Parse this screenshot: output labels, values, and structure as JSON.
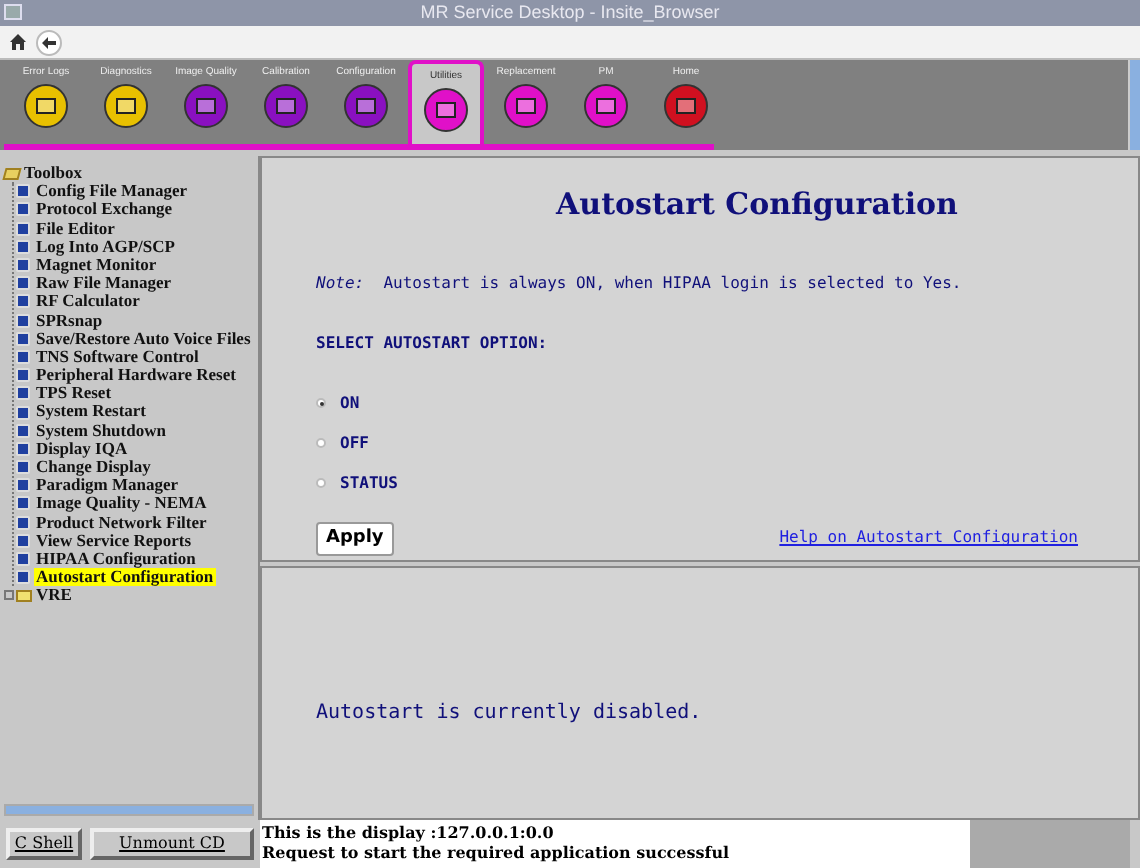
{
  "window": {
    "title": "MR Service Desktop - Insite_Browser"
  },
  "toolbar": [
    {
      "label": "Error Logs",
      "color": "#e8c000",
      "selected": false
    },
    {
      "label": "Diagnostics",
      "color": "#e8c000",
      "selected": false
    },
    {
      "label": "Image Quality",
      "color": "#8a10c0",
      "selected": false
    },
    {
      "label": "Calibration",
      "color": "#8a10c0",
      "selected": false
    },
    {
      "label": "Configuration",
      "color": "#8a10c0",
      "selected": false
    },
    {
      "label": "Utilities",
      "color": "#e010c8",
      "selected": true
    },
    {
      "label": "Replacement",
      "color": "#e010c8",
      "selected": false
    },
    {
      "label": "PM",
      "color": "#e010c8",
      "selected": false
    },
    {
      "label": "Home",
      "color": "#d01020",
      "selected": false
    }
  ],
  "tree": [
    {
      "label": "Toolbox",
      "expanded": true,
      "children": [
        {
          "label": "Config File Manager",
          "selected": false
        },
        {
          "label": "Protocol Exchange",
          "selected": false
        },
        {
          "label": "File Editor",
          "selected": false
        },
        {
          "label": "Log Into AGP/SCP",
          "selected": false
        },
        {
          "label": "Magnet Monitor",
          "selected": false
        },
        {
          "label": "Raw File Manager",
          "selected": false
        },
        {
          "label": "RF Calculator",
          "selected": false
        },
        {
          "label": "SPRsnap",
          "selected": false
        },
        {
          "label": "Save/Restore Auto Voice Files",
          "selected": false
        },
        {
          "label": "TNS Software Control",
          "selected": false
        },
        {
          "label": "Peripheral Hardware Reset",
          "selected": false
        },
        {
          "label": "TPS Reset",
          "selected": false
        },
        {
          "label": "System Restart",
          "selected": false
        },
        {
          "label": "System Shutdown",
          "selected": false
        },
        {
          "label": "Display IQA",
          "selected": false
        },
        {
          "label": "Change Display",
          "selected": false
        },
        {
          "label": "Paradigm Manager",
          "selected": false
        },
        {
          "label": "Image Quality - NEMA",
          "selected": false
        },
        {
          "label": "Product Network Filter",
          "selected": false
        },
        {
          "label": "View Service Reports",
          "selected": false
        },
        {
          "label": "HIPAA Configuration",
          "selected": false
        },
        {
          "label": "Autostart Configuration",
          "selected": true
        }
      ]
    },
    {
      "label": "VRE",
      "expanded": false
    }
  ],
  "content": {
    "heading": "Autostart Configuration",
    "note_label": "Note:",
    "note": "Autostart is always ON, when HIPAA login is selected to Yes.",
    "option_heading": "SELECT AUTOSTART OPTION:",
    "options": [
      {
        "label": "ON",
        "selected": true
      },
      {
        "label": "OFF",
        "selected": false
      },
      {
        "label": "STATUS",
        "selected": false
      }
    ],
    "apply": "Apply",
    "help_link": "Help on Autostart Configuration",
    "status": "Autostart is currently disabled."
  },
  "bottom_buttons": [
    "C Shell",
    "Unmount CD"
  ],
  "messages": [
    "This is the display :127.0.0.1:0.0",
    "Request to start the required application successful"
  ]
}
